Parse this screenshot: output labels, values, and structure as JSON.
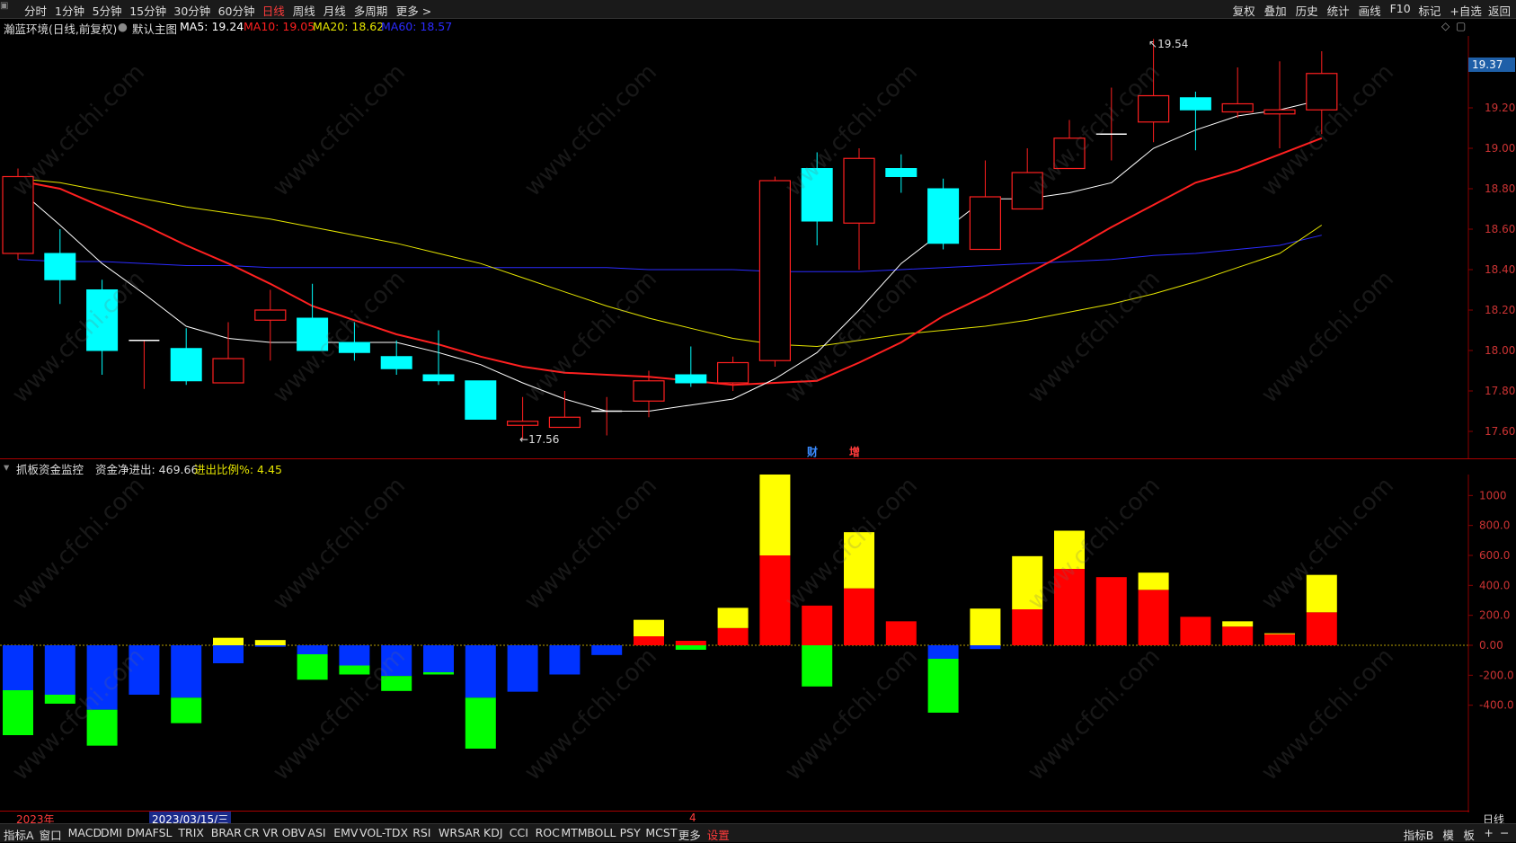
{
  "top_toolbar": {
    "left": [
      "分时",
      "1分钟",
      "5分钟",
      "15分钟",
      "30分钟",
      "60分钟",
      "日线",
      "周线",
      "月线",
      "多周期",
      "更多 >"
    ],
    "active": "日线",
    "right": [
      "复权",
      "叠加",
      "历史",
      "统计",
      "画线",
      "F10",
      "标记",
      "+自选",
      "返回"
    ]
  },
  "main_chart": {
    "stock_title": "瀚蓝环境(日线,前复权)",
    "template": "默认主图",
    "ma": [
      {
        "label": "MA5: 19.24",
        "color": "#ffffff"
      },
      {
        "label": "MA10: 19.05",
        "color": "#ff2020"
      },
      {
        "label": "MA20: 18.62",
        "color": "#e5e500"
      },
      {
        "label": "MA60: 18.57",
        "color": "#2b2bff"
      }
    ],
    "y_ticks": [
      "19.20",
      "19.00",
      "18.80",
      "18.60",
      "18.40",
      "18.20",
      "18.00",
      "17.80",
      "17.60"
    ],
    "current_price": "19.37",
    "high_label": "19.54",
    "low_label": "17.56",
    "event_tags": [
      "财",
      "增"
    ],
    "candles": [
      {
        "o": 18.48,
        "h": 18.9,
        "l": 18.45,
        "c": 18.86
      },
      {
        "o": 18.48,
        "h": 18.6,
        "l": 18.23,
        "c": 18.35
      },
      {
        "o": 18.3,
        "h": 18.35,
        "l": 17.88,
        "c": 18.0
      },
      {
        "o": 18.05,
        "h": 18.05,
        "l": 17.81,
        "c": 18.05
      },
      {
        "o": 18.01,
        "h": 18.11,
        "l": 17.83,
        "c": 17.85
      },
      {
        "o": 17.84,
        "h": 18.14,
        "l": 17.84,
        "c": 17.96
      },
      {
        "o": 18.15,
        "h": 18.3,
        "l": 17.95,
        "c": 18.2
      },
      {
        "o": 18.16,
        "h": 18.33,
        "l": 18.0,
        "c": 18.0
      },
      {
        "o": 18.04,
        "h": 18.14,
        "l": 17.95,
        "c": 17.99
      },
      {
        "o": 17.97,
        "h": 18.05,
        "l": 17.88,
        "c": 17.91
      },
      {
        "o": 17.88,
        "h": 18.1,
        "l": 17.83,
        "c": 17.85
      },
      {
        "o": 17.85,
        "h": 17.85,
        "l": 17.66,
        "c": 17.66
      },
      {
        "o": 17.63,
        "h": 17.77,
        "l": 17.56,
        "c": 17.65
      },
      {
        "o": 17.62,
        "h": 17.8,
        "l": 17.62,
        "c": 17.67
      },
      {
        "o": 17.7,
        "h": 17.77,
        "l": 17.58,
        "c": 17.7
      },
      {
        "o": 17.75,
        "h": 17.9,
        "l": 17.67,
        "c": 17.85
      },
      {
        "o": 17.88,
        "h": 18.02,
        "l": 17.82,
        "c": 17.84
      },
      {
        "o": 17.84,
        "h": 17.97,
        "l": 17.8,
        "c": 17.94
      },
      {
        "o": 17.95,
        "h": 18.86,
        "l": 17.92,
        "c": 18.84
      },
      {
        "o": 18.9,
        "h": 18.98,
        "l": 18.52,
        "c": 18.64
      },
      {
        "o": 18.63,
        "h": 19.0,
        "l": 18.4,
        "c": 18.95
      },
      {
        "o": 18.9,
        "h": 18.97,
        "l": 18.78,
        "c": 18.86
      },
      {
        "o": 18.8,
        "h": 18.85,
        "l": 18.5,
        "c": 18.53
      },
      {
        "o": 18.5,
        "h": 18.94,
        "l": 18.5,
        "c": 18.76
      },
      {
        "o": 18.7,
        "h": 19.0,
        "l": 18.7,
        "c": 18.88
      },
      {
        "o": 18.9,
        "h": 19.14,
        "l": 18.9,
        "c": 19.05
      },
      {
        "o": 19.07,
        "h": 19.3,
        "l": 18.94,
        "c": 19.07
      },
      {
        "o": 19.13,
        "h": 19.54,
        "l": 19.03,
        "c": 19.26
      },
      {
        "o": 19.25,
        "h": 19.28,
        "l": 18.99,
        "c": 19.19
      },
      {
        "o": 19.18,
        "h": 19.4,
        "l": 19.15,
        "c": 19.22
      },
      {
        "o": 19.17,
        "h": 19.43,
        "l": 19.0,
        "c": 19.19
      },
      {
        "o": 19.19,
        "h": 19.48,
        "l": 19.07,
        "c": 19.37
      }
    ],
    "ma5": [
      18.8,
      18.62,
      18.43,
      18.28,
      18.12,
      18.06,
      18.04,
      18.04,
      18.04,
      18.04,
      17.99,
      17.93,
      17.84,
      17.76,
      17.7,
      17.7,
      17.73,
      17.76,
      17.86,
      17.99,
      18.2,
      18.43,
      18.59,
      18.75,
      18.75,
      18.78,
      18.83,
      19.0,
      19.09,
      19.16,
      19.19,
      19.24
    ],
    "ma10": [
      18.84,
      18.8,
      18.71,
      18.62,
      18.52,
      18.43,
      18.33,
      18.22,
      18.15,
      18.08,
      18.03,
      17.97,
      17.92,
      17.89,
      17.88,
      17.87,
      17.85,
      17.83,
      17.84,
      17.85,
      17.94,
      18.04,
      18.17,
      18.27,
      18.38,
      18.49,
      18.61,
      18.72,
      18.83,
      18.89,
      18.97,
      19.05
    ],
    "ma20": [
      18.85,
      18.83,
      18.79,
      18.75,
      18.71,
      18.68,
      18.65,
      18.61,
      18.57,
      18.53,
      18.48,
      18.43,
      18.36,
      18.29,
      18.22,
      18.16,
      18.11,
      18.06,
      18.03,
      18.02,
      18.05,
      18.08,
      18.1,
      18.12,
      18.15,
      18.19,
      18.23,
      18.28,
      18.34,
      18.41,
      18.48,
      18.62
    ],
    "ma60": [
      18.45,
      18.44,
      18.44,
      18.43,
      18.42,
      18.42,
      18.41,
      18.41,
      18.41,
      18.41,
      18.41,
      18.41,
      18.41,
      18.41,
      18.41,
      18.4,
      18.4,
      18.4,
      18.39,
      18.39,
      18.39,
      18.4,
      18.41,
      18.42,
      18.43,
      18.44,
      18.45,
      18.47,
      18.48,
      18.5,
      18.52,
      18.57
    ]
  },
  "sub_chart": {
    "title": "抓板资金监控",
    "net_label": "资金净进出: 469.66",
    "ratio_label": "进出比例%: 4.45",
    "y_ticks": [
      "1200",
      "1000",
      "800.0",
      "600.0",
      "400.0",
      "200.0",
      "0.00",
      "-200.0",
      "-400.0"
    ],
    "bars": [
      {
        "p": -300,
        "s": -300
      },
      {
        "p": -330,
        "s": -60
      },
      {
        "p": -430,
        "s": -240
      },
      {
        "p": -330,
        "s": 0
      },
      {
        "p": -350,
        "s": -170
      },
      {
        "p": -120,
        "s": 50
      },
      {
        "p": -10,
        "s": 35
      },
      {
        "p": -60,
        "s": -170
      },
      {
        "p": -135,
        "s": -60
      },
      {
        "p": -205,
        "s": -100
      },
      {
        "p": -180,
        "s": -15
      },
      {
        "p": -350,
        "s": -340
      },
      {
        "p": -310,
        "s": 0
      },
      {
        "p": -195,
        "s": 0
      },
      {
        "p": -65,
        "s": 0
      },
      {
        "p": 60,
        "s": 110
      },
      {
        "p": 30,
        "s": -30
      },
      {
        "p": 115,
        "s": 135
      },
      {
        "p": 600,
        "s": 745
      },
      {
        "p": 265,
        "s": -275
      },
      {
        "p": 380,
        "s": 375
      },
      {
        "p": 160,
        "s": 0
      },
      {
        "p": -90,
        "s": -360
      },
      {
        "p": -25,
        "s": 245
      },
      {
        "p": 240,
        "s": 355
      },
      {
        "p": 510,
        "s": 255
      },
      {
        "p": 455,
        "s": 0
      },
      {
        "p": 370,
        "s": 115
      },
      {
        "p": 190,
        "s": 0
      },
      {
        "p": 125,
        "s": 35
      },
      {
        "p": 75,
        "s": 5
      },
      {
        "p": 220,
        "s": 250
      }
    ]
  },
  "timeline": {
    "year_label": "2023年",
    "date_label": "2023/03/15/三",
    "marker": "4",
    "period": "日线"
  },
  "bottom_toolbar": {
    "left": [
      "指标A",
      "窗口",
      "MACD",
      "DMI",
      "DMA",
      "FSL",
      "TRIX",
      "BRAR",
      "CR",
      "VR",
      "OBV",
      "ASI",
      "EMV",
      "VOL-TDX",
      "RSI",
      "WR",
      "SAR",
      "KDJ",
      "CCI",
      "ROC",
      "MTM",
      "BOLL",
      "PSY",
      "MCST",
      "更多",
      "设置"
    ],
    "right": [
      "指标B",
      "模",
      "板",
      "+",
      "−"
    ]
  },
  "watermark": "www.cfchi.com",
  "colors": {
    "up": "#ff2020",
    "down": "#00ffff",
    "ma5": "#ffffff",
    "ma10": "#ff2020",
    "ma20": "#e5e500",
    "ma60": "#2b2bff",
    "sub_red": "#ff0000",
    "sub_yellow": "#ffff00",
    "sub_blue": "#0033ff",
    "sub_green": "#00ff00",
    "grid": "#8b0000"
  }
}
